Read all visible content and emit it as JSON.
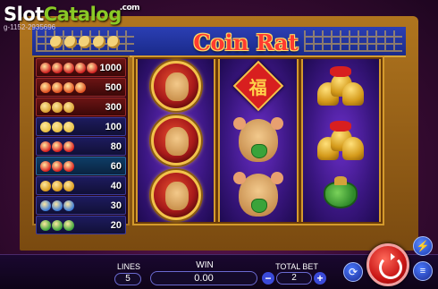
{
  "watermark": {
    "slot": "Slot",
    "catalog": "Catalog",
    "com": ".com",
    "sub": "g-1152-2935696"
  },
  "game": {
    "title": "Coin Rat"
  },
  "paytable": {
    "rows": [
      {
        "value": "1000",
        "colors": [
          "#d02020",
          "#d02020",
          "#d02020",
          "#d02020",
          "#d02020"
        ]
      },
      {
        "value": "500",
        "colors": [
          "#e05020",
          "#e05020",
          "#e05020",
          "#e05020"
        ]
      },
      {
        "value": "300",
        "colors": [
          "#d8a030",
          "#d8a030",
          "#d8a030"
        ]
      },
      {
        "value": "100",
        "colors": [
          "#e8c040",
          "#e8c040",
          "#e8c040"
        ]
      },
      {
        "value": "80",
        "colors": [
          "#d81f1f",
          "#d81f1f",
          "#d81f1f"
        ]
      },
      {
        "value": "60",
        "colors": [
          "#d81f1f",
          "#d81f1f",
          "#d81f1f"
        ]
      },
      {
        "value": "40",
        "colors": [
          "#d89a1a",
          "#d89a1a",
          "#d89a1a"
        ]
      },
      {
        "value": "30",
        "colors": [
          "#3a7ad8",
          "#3a7ad8",
          "#3a7ad8"
        ]
      },
      {
        "value": "20",
        "colors": [
          "#3aa33a",
          "#3aa33a",
          "#3aa33a"
        ]
      }
    ]
  },
  "reels": [
    [
      "wild-rat-coin",
      "wild-rat-coin",
      "wild-rat-coin"
    ],
    [
      "fu-symbol",
      "rat-with-sack",
      "rat-with-sack"
    ],
    [
      "golden-bells",
      "golden-bells",
      "green-pouch"
    ]
  ],
  "fu_char": "福",
  "controls": {
    "lines_label": "LINES",
    "lines_value": "5",
    "win_label": "WIN",
    "win_value": "0.00",
    "total_bet_label": "TOTAL BET",
    "total_bet_value": "2",
    "minus": "−",
    "plus": "+",
    "turbo_icon": "lightning-icon",
    "auto_icon": "autoplay-icon",
    "coins_icon": "coin-stack-icon",
    "spin_icon": "spin-arrow-icon"
  }
}
